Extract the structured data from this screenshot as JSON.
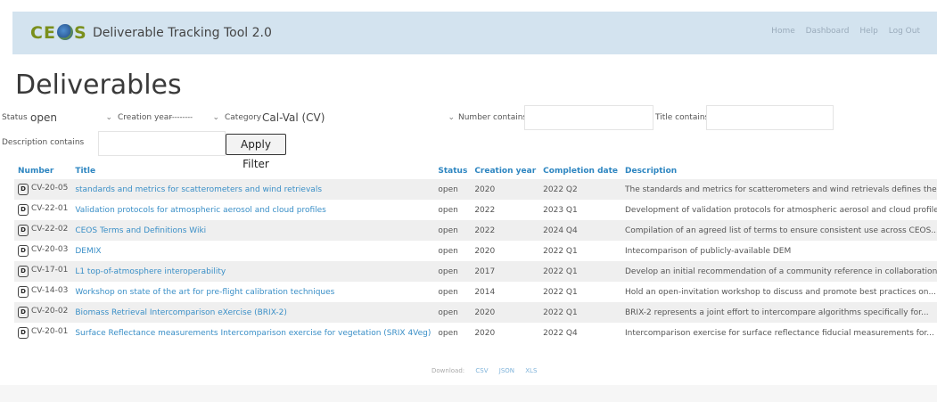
{
  "header": {
    "logo_pre": "CE",
    "logo_post": "S",
    "app_title": "Deliverable Tracking Tool 2.0",
    "nav": [
      "Home",
      "Dashboard",
      "Help",
      "Log Out"
    ],
    "brand_color": "#7a8f1c",
    "bar_color": "#d3e3ef"
  },
  "page": {
    "title": "Deliverables"
  },
  "filters": {
    "status_label": "Status",
    "status_value": "open",
    "creation_year_label": "Creation year",
    "creation_year_value": "---------",
    "category_label": "Category",
    "category_value": "Cal-Val (CV)",
    "number_label": "Number contains",
    "number_value": "",
    "title_label": "Title contains",
    "title_value": "",
    "description_label": "Description contains",
    "description_value": "",
    "apply_label": "Apply Filter"
  },
  "table": {
    "columns": [
      "Number",
      "Title",
      "Status",
      "Creation year",
      "Completion date",
      "Description"
    ],
    "rows": [
      {
        "badge": "D",
        "number": "CV-20-05",
        "title": "standards and metrics for scatterometers and wind retrievals",
        "status": "open",
        "year": "2020",
        "completion": "2022 Q2",
        "description": "The standards and metrics for scatterometers and wind retrievals defines the..."
      },
      {
        "badge": "D",
        "number": "CV-22-01",
        "title": "Validation protocols for atmospheric aerosol and cloud profiles",
        "status": "open",
        "year": "2022",
        "completion": "2023 Q1",
        "description": "Development of validation protocols for atmospheric aerosol and cloud profiles"
      },
      {
        "badge": "D",
        "number": "CV-22-02",
        "title": "CEOS Terms and Definitions Wiki",
        "status": "open",
        "year": "2022",
        "completion": "2024 Q4",
        "description": "Compilation of an agreed list of terms to ensure consistent use across CEOS..."
      },
      {
        "badge": "D",
        "number": "CV-20-03",
        "title": "DEMIX",
        "status": "open",
        "year": "2020",
        "completion": "2022 Q1",
        "description": "Intecomparison of publicly-available DEM"
      },
      {
        "badge": "D",
        "number": "CV-17-01",
        "title": "L1 top-of-atmosphere interoperability",
        "status": "open",
        "year": "2017",
        "completion": "2022 Q1",
        "description": "Develop an initial recommendation of a community reference in collaboration..."
      },
      {
        "badge": "D",
        "number": "CV-14-03",
        "title": "Workshop on state of the art for pre-flight calibration techniques",
        "status": "open",
        "year": "2014",
        "completion": "2022 Q1",
        "description": "Hold an open-invitation workshop to discuss and promote best practices on..."
      },
      {
        "badge": "D",
        "number": "CV-20-02",
        "title": "Biomass Retrieval Intercomparison eXercise (BRIX-2)",
        "status": "open",
        "year": "2020",
        "completion": "2022 Q1",
        "description": "BRIX-2 represents a joint effort to intercompare algorithms specifically for..."
      },
      {
        "badge": "D",
        "number": "CV-20-01",
        "title": "Surface Reflectance measurements Intercomparison exercise for vegetation (SRIX 4Veg)",
        "status": "open",
        "year": "2020",
        "completion": "2022 Q4",
        "description": "Intercomparison exercise for surface reflectance fiducial measurements for..."
      }
    ]
  },
  "download": {
    "label": "Download:",
    "formats": [
      "CSV",
      "JSON",
      "XLS"
    ]
  }
}
